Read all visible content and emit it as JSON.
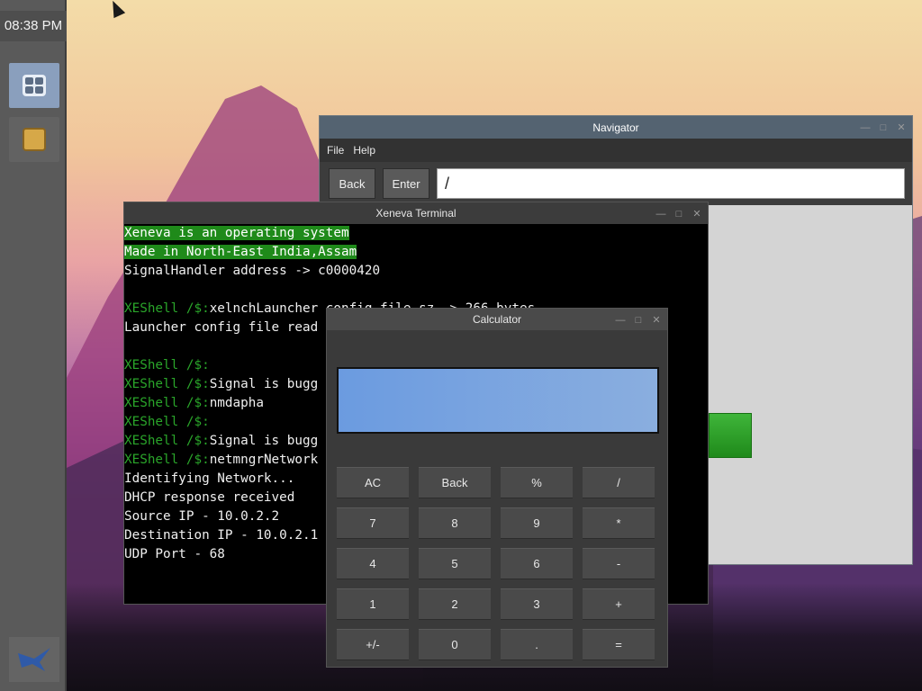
{
  "taskbar": {
    "clock": "08:38 PM",
    "dock": [
      {
        "name": "calculator",
        "icon": "calculator-icon"
      },
      {
        "name": "files",
        "icon": "files-icon"
      }
    ],
    "logo_icon": "xeneva-logo-icon"
  },
  "navigator": {
    "title": "Navigator",
    "menu": [
      "File",
      "Help"
    ],
    "back_label": "Back",
    "enter_label": "Enter",
    "path": "/",
    "accent_item_color": "#2a9a22"
  },
  "terminal": {
    "title": "Xeneva Terminal",
    "lines": [
      {
        "prompt": "",
        "text": "Xeneva is an operating system",
        "highlight": true
      },
      {
        "prompt": "",
        "text": "Made in North-East India,Assam",
        "highlight": true
      },
      {
        "prompt": "",
        "text": "SignalHandler address -> c0000420",
        "highlight": false
      },
      {
        "prompt": "",
        "text": "",
        "highlight": false
      },
      {
        "prompt": "XEShell /$:",
        "text": "xelnchLauncher config file sz -> 266 bytes",
        "highlight": false
      },
      {
        "prompt": "",
        "text": "Launcher config file read",
        "highlight": false
      },
      {
        "prompt": "",
        "text": "",
        "highlight": false
      },
      {
        "prompt": "XEShell /$:",
        "text": "",
        "highlight": false
      },
      {
        "prompt": "XEShell /$:",
        "text": "Signal is bugg",
        "highlight": false
      },
      {
        "prompt": "XEShell /$:",
        "text": "nmdapha",
        "highlight": false
      },
      {
        "prompt": "XEShell /$:",
        "text": "",
        "highlight": false
      },
      {
        "prompt": "XEShell /$:",
        "text": "Signal is bugg",
        "highlight": false
      },
      {
        "prompt": "XEShell /$:",
        "text": "netmngrNetwork",
        "highlight": false
      },
      {
        "prompt": "",
        "text": "Identifying Network...",
        "highlight": false
      },
      {
        "prompt": "",
        "text": "DHCP response received",
        "highlight": false
      },
      {
        "prompt": "",
        "text": "Source IP - 10.0.2.2",
        "highlight": false
      },
      {
        "prompt": "",
        "text": "Destination IP - 10.0.2.1",
        "highlight": false
      },
      {
        "prompt": "",
        "text": "UDP Port - 68",
        "highlight": false
      }
    ]
  },
  "calculator": {
    "title": "Calculator",
    "display_value": "",
    "keys": [
      [
        "AC",
        "Back",
        "%",
        "/"
      ],
      [
        "7",
        "8",
        "9",
        "*"
      ],
      [
        "4",
        "5",
        "6",
        "-"
      ],
      [
        "1",
        "2",
        "3",
        "+"
      ],
      [
        "+/-",
        "0",
        ".",
        "="
      ]
    ]
  },
  "colors": {
    "taskbar": "#5a5a5a",
    "navigator_title": "#546371",
    "terminal_highlight": "#1f8a1a",
    "terminal_prompt": "#2aa52a",
    "calc_display": "#6b9be0"
  }
}
